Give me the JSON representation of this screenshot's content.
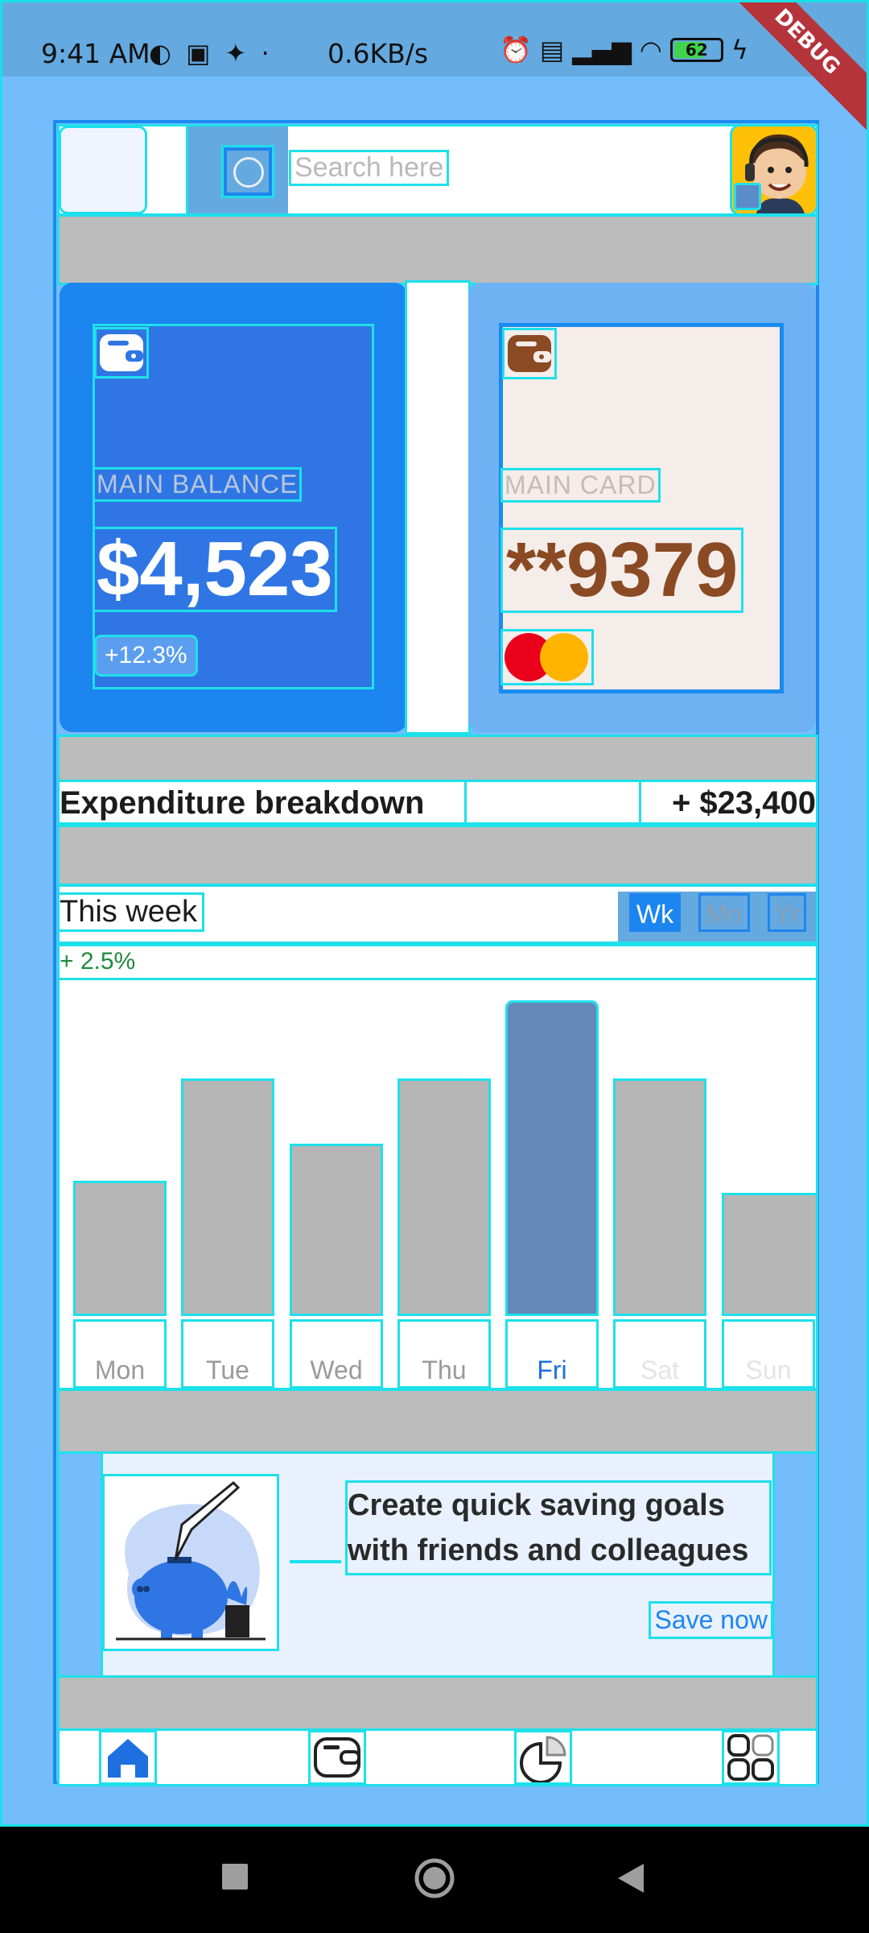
{
  "status_bar": {
    "time": "9:41 AM",
    "net_speed": "0.6KB/s",
    "battery_level": "62",
    "debug_banner": "DEBUG"
  },
  "header": {
    "search_placeholder": "Search here"
  },
  "balance_card": {
    "label": "MAIN BALANCE",
    "amount": "$4,523",
    "change": "+12.3%"
  },
  "main_card": {
    "label": "MAIN CARD",
    "number": "**9379"
  },
  "expenditure": {
    "title": "Expenditure breakdown",
    "total": "+ $23,400"
  },
  "period": {
    "label": "This week",
    "options": [
      "Wk",
      "Mn",
      "Yr"
    ],
    "selected": "Wk",
    "change": "+ 2.5%"
  },
  "chart_data": {
    "type": "bar",
    "categories": [
      "Mon",
      "Tue",
      "Wed",
      "Thu",
      "Fri",
      "Sat",
      "Sun"
    ],
    "values": [
      0.42,
      0.75,
      0.54,
      0.75,
      1.0,
      0.75,
      0.38
    ],
    "highlighted": "Fri",
    "colors": {
      "bar": "#b6b6b6",
      "highlight": "#6389b9"
    }
  },
  "promo": {
    "title": "Create quick saving goals with friends and colleagues",
    "cta": "Save now"
  },
  "bottom_nav": {
    "items": [
      "home-icon",
      "wallet-icon",
      "pie-chart-icon",
      "grid-icon"
    ],
    "active": "home-icon"
  },
  "colors": {
    "primary": "#1c85ef",
    "background": "#73bdfd",
    "card_brown": "#8a4a24",
    "positive": "#1e8a3e"
  }
}
